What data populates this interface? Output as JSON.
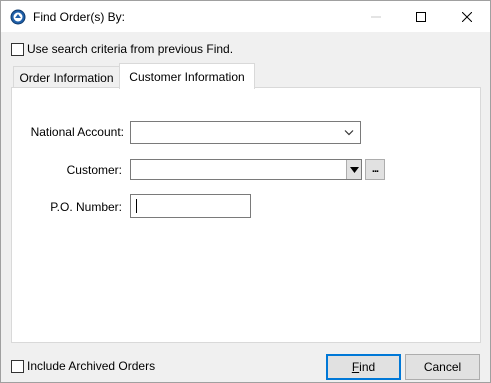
{
  "window": {
    "title": "Find Order(s) By:"
  },
  "options": {
    "use_previous_label": "Use search criteria from previous Find.",
    "use_previous_checked": false,
    "include_archived_label": "Include Archived Orders",
    "include_archived_checked": false
  },
  "tabs": [
    {
      "label": "Order Information",
      "active": false
    },
    {
      "label": "Customer Information",
      "active": true
    }
  ],
  "form": {
    "national_account_label": "National Account:",
    "national_account_value": "",
    "customer_label": "Customer:",
    "customer_value": "",
    "customer_lookup_label": "...",
    "po_number_label": "P.O. Number:",
    "po_number_value": ""
  },
  "buttons": {
    "find_access_key": "F",
    "find_rest": "ind",
    "cancel": "Cancel"
  },
  "colors": {
    "accent": "#0078d7",
    "window_bg": "#f0f0f0",
    "panel_bg": "#ffffff"
  }
}
